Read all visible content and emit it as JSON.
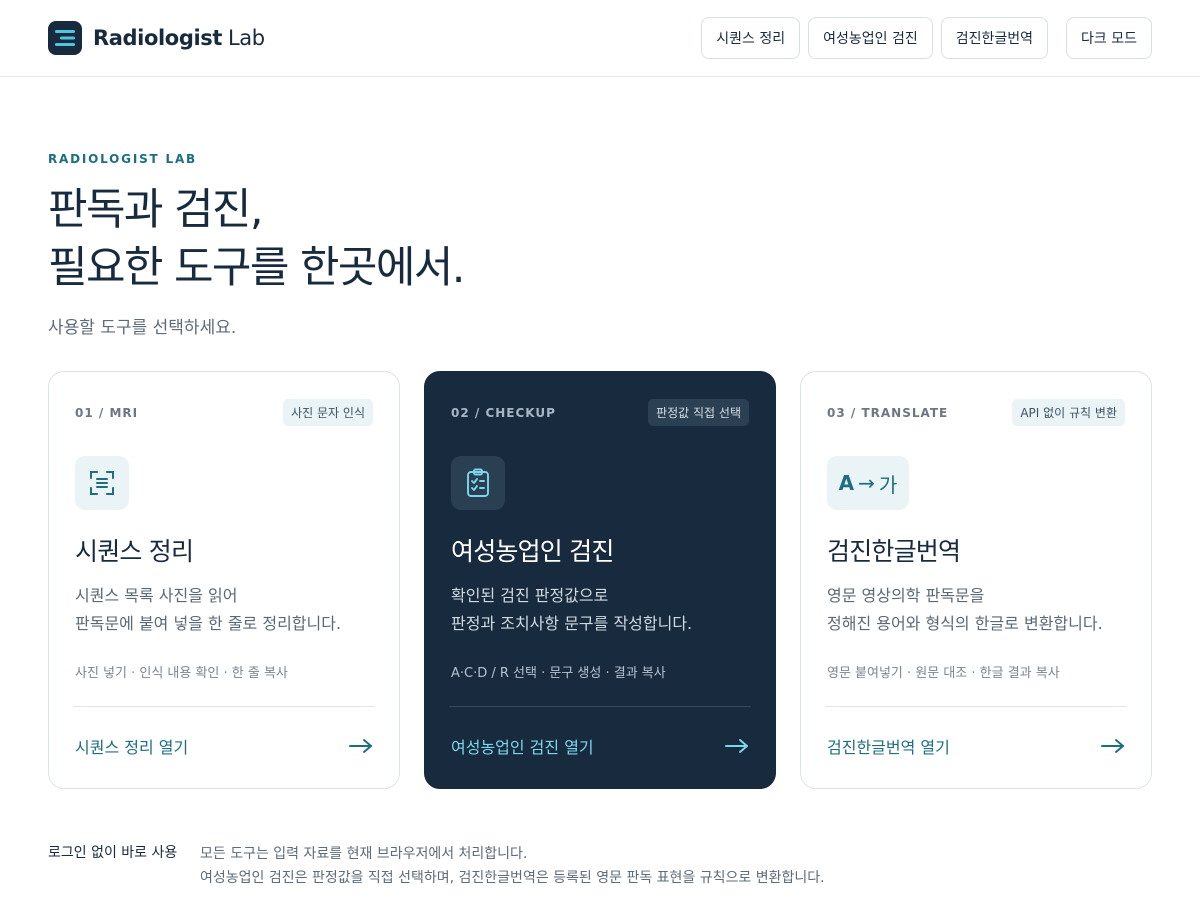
{
  "header": {
    "brand": {
      "name_bold": "Radiologist",
      "name_light": "Lab",
      "logo_icon": "menu-lines-icon"
    },
    "nav": [
      {
        "label": "시퀀스 정리"
      },
      {
        "label": "여성농업인 검진"
      },
      {
        "label": "검진한글번역"
      }
    ],
    "theme_toggle": {
      "label": "다크 모드"
    }
  },
  "hero": {
    "eyebrow": "RADIOLOGIST LAB",
    "title_lines": [
      "판독과 검진,",
      "필요한 도구를 한곳에서."
    ],
    "subtitle": "사용할 도구를 선택하세요."
  },
  "cards": [
    {
      "index": "01 / MRI",
      "tag": "사진 문자 인식",
      "icon": "document-scan-icon",
      "title": "시퀀스 정리",
      "desc_lines": [
        "시퀀스 목록 사진을 읽어",
        "판독문에 붙여 넣을 한 줄로 정리합니다."
      ],
      "meta": "사진 넣기 · 인식 내용 확인 · 한 줄 복사",
      "link_label": "시퀀스 정리 열기",
      "link_icon": "arrow-right-icon"
    },
    {
      "index": "02 / CHECKUP",
      "tag": "판정값 직접 선택",
      "icon": "clipboard-check-icon",
      "title": "여성농업인 검진",
      "desc_lines": [
        "확인된 검진 판정값으로",
        "판정과 조치사항 문구를 작성합니다."
      ],
      "meta": "A·C·D / R 선택 · 문구 생성 · 결과 복사",
      "link_label": "여성농업인 검진 열기",
      "link_icon": "arrow-right-icon"
    },
    {
      "index": "03 / TRANSLATE",
      "tag": "API 없이 규칙 변환",
      "icon": "translate-icon",
      "icon_text": {
        "a": "A",
        "arrow": "→",
        "ga": "가"
      },
      "title": "검진한글번역",
      "desc_lines": [
        "영문 영상의학 판독문을",
        "정해진 용어와 형식의 한글로 변환합니다."
      ],
      "meta": "영문 붙여넣기 · 원문 대조 · 한글 결과 복사",
      "link_label": "검진한글번역 열기",
      "link_icon": "arrow-right-icon"
    }
  ],
  "footer": {
    "label": "로그인 없이 바로 사용",
    "lines": [
      "모든 도구는 입력 자료를 현재 브라우저에서 처리합니다.",
      "여성농업인 검진은 판정값을 직접 선택하며, 검진한글번역은 등록된 영문 판독 표현을 규칙으로 변환합니다."
    ]
  },
  "colors": {
    "navy": "#172a3e",
    "teal_accent": "#1c6e80",
    "teal_light": "#7cd7ea",
    "icon_bg": "#eaf4f7",
    "border": "#dde3ea"
  }
}
